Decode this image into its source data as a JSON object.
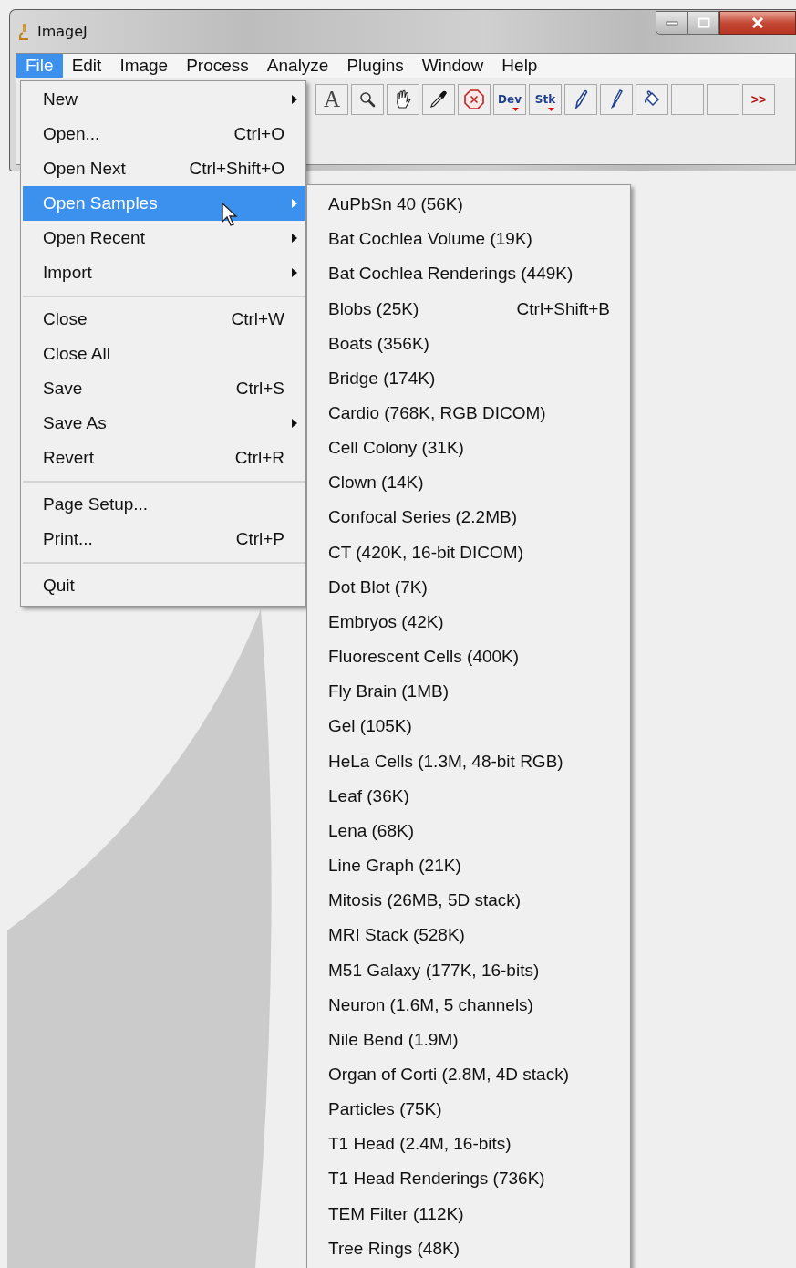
{
  "window": {
    "title": "ImageJ"
  },
  "menubar": [
    {
      "label": "File",
      "selected": true
    },
    {
      "label": "Edit",
      "selected": false
    },
    {
      "label": "Image",
      "selected": false
    },
    {
      "label": "Process",
      "selected": false
    },
    {
      "label": "Analyze",
      "selected": false
    },
    {
      "label": "Plugins",
      "selected": false
    },
    {
      "label": "Window",
      "selected": false
    },
    {
      "label": "Help",
      "selected": false
    }
  ],
  "toolbar": [
    {
      "kind": "text",
      "label": "A"
    },
    {
      "kind": "zoom"
    },
    {
      "kind": "hand"
    },
    {
      "kind": "dropper"
    },
    {
      "kind": "stop"
    },
    {
      "kind": "menu-text",
      "label": "Dev"
    },
    {
      "kind": "menu-text",
      "label": "Stk"
    },
    {
      "kind": "pencil"
    },
    {
      "kind": "brush"
    },
    {
      "kind": "bucket"
    },
    {
      "kind": "blank"
    },
    {
      "kind": "blank"
    },
    {
      "kind": "more",
      "label": ">>"
    }
  ],
  "file_menu": {
    "groups": [
      [
        {
          "label": "New",
          "submenu": true,
          "selected": false
        },
        {
          "label": "Open...",
          "shortcut": "Ctrl+O",
          "submenu": false,
          "selected": false
        },
        {
          "label": "Open Next",
          "shortcut": "Ctrl+Shift+O",
          "submenu": false,
          "selected": false
        },
        {
          "label": "Open Samples",
          "submenu": true,
          "selected": true
        },
        {
          "label": "Open Recent",
          "submenu": true,
          "selected": false
        },
        {
          "label": "Import",
          "submenu": true,
          "selected": false
        }
      ],
      [
        {
          "label": "Close",
          "shortcut": "Ctrl+W",
          "submenu": false,
          "selected": false
        },
        {
          "label": "Close All",
          "submenu": false,
          "selected": false
        },
        {
          "label": "Save",
          "shortcut": "Ctrl+S",
          "submenu": false,
          "selected": false
        },
        {
          "label": "Save As",
          "submenu": true,
          "selected": false
        },
        {
          "label": "Revert",
          "shortcut": "Ctrl+R",
          "submenu": false,
          "selected": false
        }
      ],
      [
        {
          "label": "Page Setup...",
          "submenu": false,
          "selected": false
        },
        {
          "label": "Print...",
          "shortcut": "Ctrl+P",
          "submenu": false,
          "selected": false
        }
      ],
      [
        {
          "label": "Quit",
          "submenu": false,
          "selected": false
        }
      ]
    ]
  },
  "samples_menu": {
    "items": [
      {
        "label": "AuPbSn 40 (56K)"
      },
      {
        "label": "Bat Cochlea Volume (19K)"
      },
      {
        "label": "Bat Cochlea Renderings (449K)"
      },
      {
        "label": "Blobs (25K)",
        "shortcut": "Ctrl+Shift+B"
      },
      {
        "label": "Boats (356K)"
      },
      {
        "label": "Bridge (174K)"
      },
      {
        "label": "Cardio (768K, RGB DICOM)"
      },
      {
        "label": "Cell Colony (31K)"
      },
      {
        "label": "Clown (14K)"
      },
      {
        "label": "Confocal Series (2.2MB)"
      },
      {
        "label": "CT (420K, 16-bit DICOM)"
      },
      {
        "label": "Dot Blot (7K)"
      },
      {
        "label": "Embryos (42K)"
      },
      {
        "label": "Fluorescent Cells (400K)"
      },
      {
        "label": "Fly Brain (1MB)"
      },
      {
        "label": "Gel (105K)"
      },
      {
        "label": "HeLa Cells (1.3M, 48-bit RGB)"
      },
      {
        "label": "Leaf (36K)"
      },
      {
        "label": "Lena (68K)"
      },
      {
        "label": "Line Graph (21K)"
      },
      {
        "label": "Mitosis (26MB, 5D stack)"
      },
      {
        "label": "MRI Stack (528K)"
      },
      {
        "label": "M51 Galaxy (177K, 16-bits)"
      },
      {
        "label": "Neuron (1.6M, 5 channels)"
      },
      {
        "label": "Nile Bend (1.9M)"
      },
      {
        "label": "Organ of Corti (2.8M, 4D stack)"
      },
      {
        "label": "Particles (75K)"
      },
      {
        "label": "T1 Head (2.4M, 16-bits)"
      },
      {
        "label": "T1 Head Renderings (736K)"
      },
      {
        "label": "TEM Filter (112K)"
      },
      {
        "label": "Tree Rings (48K)"
      }
    ]
  }
}
